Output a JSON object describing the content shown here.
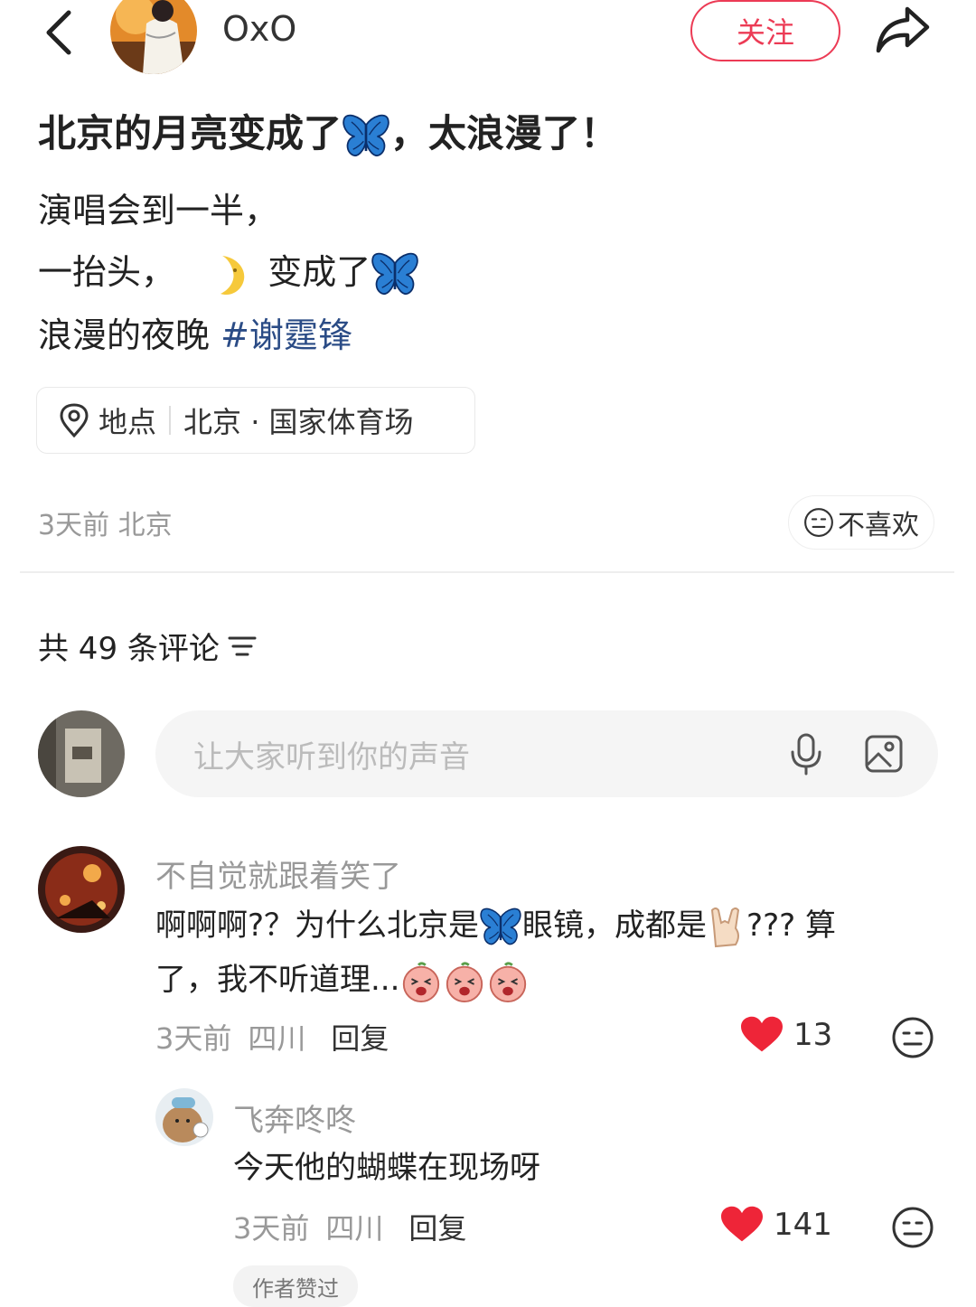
{
  "header": {
    "author_name": "OxO",
    "follow_label": "关注"
  },
  "post": {
    "title_part1": "北京的月亮变成了",
    "title_part2": "，太浪漫了！",
    "line1": "演唱会到一半，",
    "line2_part1": "一抬头，",
    "line2_part2": "变成了",
    "line3_text": "浪漫的夜晚 ",
    "hashtag": "#谢霆锋",
    "location_label": "地点",
    "location_value": "北京 · 国家体育场",
    "meta": "3天前 北京",
    "dislike_label": "不喜欢"
  },
  "comments_section": {
    "count_label": "共 49 条评论",
    "input_placeholder": "让大家听到你的声音"
  },
  "comments": [
    {
      "name": "不自觉就跟着笑了",
      "text_part1": "啊啊啊?？为什么北京是",
      "text_part2": "眼镜，成都是",
      "text_part3": "???  算",
      "text_line2": "了，我不听道理...",
      "time": "3天前",
      "region": "四川",
      "reply_label": "回复",
      "likes": "13"
    },
    {
      "name": "飞奔咚咚",
      "text": "今天他的蝴蝶在现场呀",
      "time": "3天前",
      "region": "四川",
      "reply_label": "回复",
      "likes": "141",
      "badge": "作者赞过"
    }
  ],
  "icons": {
    "back": "chevron-left-icon",
    "share": "share-arrow-icon",
    "location": "location-pin-icon",
    "dislike": "neutral-face-icon",
    "sort": "sort-lines-icon",
    "mic": "microphone-icon",
    "image": "image-icon",
    "like": "heart-icon"
  },
  "colors": {
    "accent": "#ec3b55",
    "hashtag": "#2b4c86",
    "butterfly": "#2a7fd4"
  }
}
